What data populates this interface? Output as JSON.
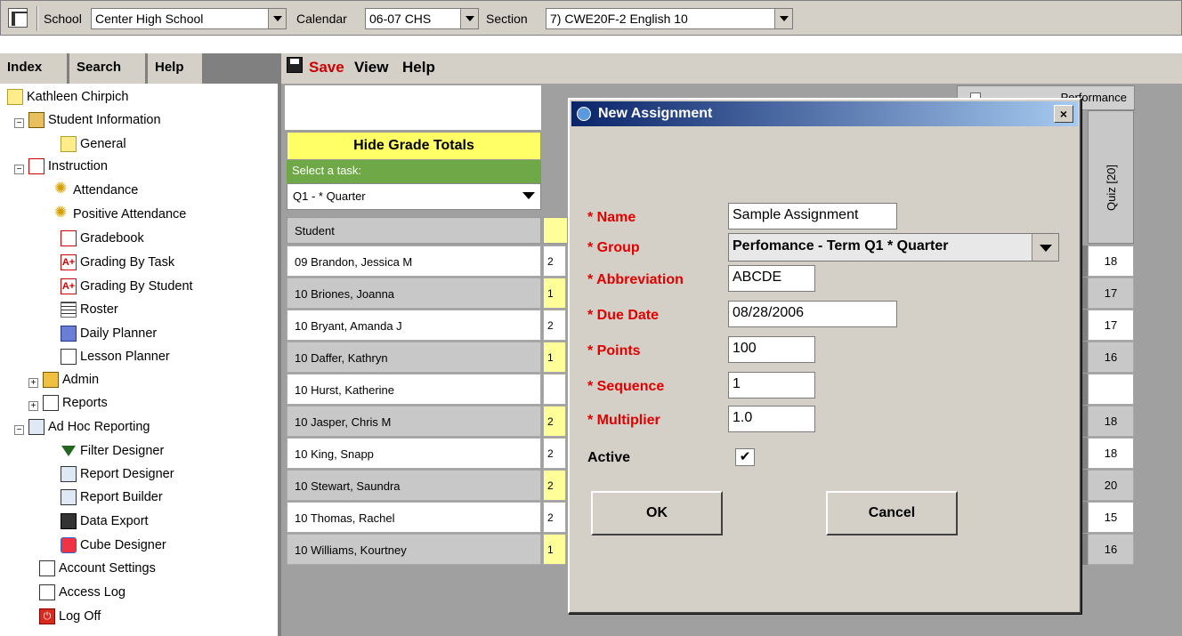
{
  "topbar": {
    "school_label": "School",
    "school_value": "Center High School",
    "calendar_label": "Calendar",
    "calendar_value": "06-07 CHS",
    "section_label": "Section",
    "section_value": "7) CWE20F-2 English 10"
  },
  "left_tabs": [
    "Index",
    "Search",
    "Help"
  ],
  "tree": {
    "user": "Kathleen Chirpich",
    "student_information": "Student Information",
    "general": "General",
    "instruction": "Instruction",
    "attendance": "Attendance",
    "positive_attendance": "Positive Attendance",
    "gradebook": "Gradebook",
    "grading_by_task": "Grading By Task",
    "grading_by_student": "Grading By Student",
    "roster": "Roster",
    "daily_planner": "Daily Planner",
    "lesson_planner": "Lesson Planner",
    "admin": "Admin",
    "reports": "Reports",
    "ad_hoc_reporting": "Ad Hoc Reporting",
    "filter_designer": "Filter Designer",
    "report_designer": "Report Designer",
    "report_builder": "Report Builder",
    "data_export": "Data Export",
    "cube_designer": "Cube Designer",
    "account_settings": "Account Settings",
    "access_log": "Access Log",
    "log_off": "Log Off"
  },
  "menubar": {
    "save": "Save",
    "view": "View",
    "help": "Help"
  },
  "gradebook": {
    "hide_totals": "Hide Grade Totals",
    "select_task_label": "Select a task:",
    "task_value": "Q1 - * Quarter",
    "student_header": "Student",
    "performance_header": "Performance",
    "quiz_header": "Quiz [20]",
    "students": [
      {
        "name": "09 Brandon, Jessica M",
        "left": "2",
        "grade": "18"
      },
      {
        "name": "10 Briones, Joanna",
        "left": "1",
        "grade": "17"
      },
      {
        "name": "10 Bryant, Amanda J",
        "left": "2",
        "grade": "17"
      },
      {
        "name": "10 Daffer, Kathryn",
        "left": "1",
        "grade": "16"
      },
      {
        "name": "10 Hurst, Katherine",
        "left": "",
        "grade": ""
      },
      {
        "name": "10 Jasper, Chris M",
        "left": "2",
        "grade": "18"
      },
      {
        "name": "10 King, Snapp",
        "left": "2",
        "grade": "18"
      },
      {
        "name": "10 Stewart, Saundra",
        "left": "2",
        "grade": "20"
      },
      {
        "name": "10 Thomas, Rachel",
        "left": "2",
        "grade": "15"
      },
      {
        "name": "10 Williams, Kourtney",
        "left": "1",
        "grade": "16"
      }
    ]
  },
  "dialog": {
    "title": "New Assignment",
    "close": "×",
    "name_label": "* Name",
    "name_value": "Sample Assignment",
    "group_label": "* Group",
    "group_value": "Perfomance - Term Q1 * Quarter",
    "abbreviation_label": "* Abbreviation",
    "abbreviation_value": "ABCDE",
    "due_date_label": "* Due Date",
    "due_date_value": "08/28/2006",
    "points_label": "* Points",
    "points_value": "100",
    "sequence_label": "* Sequence",
    "sequence_value": "1",
    "multiplier_label": "* Multiplier",
    "multiplier_value": "1.0",
    "active_label": "Active",
    "active_checked": "✔",
    "ok": "OK",
    "cancel": "Cancel"
  }
}
